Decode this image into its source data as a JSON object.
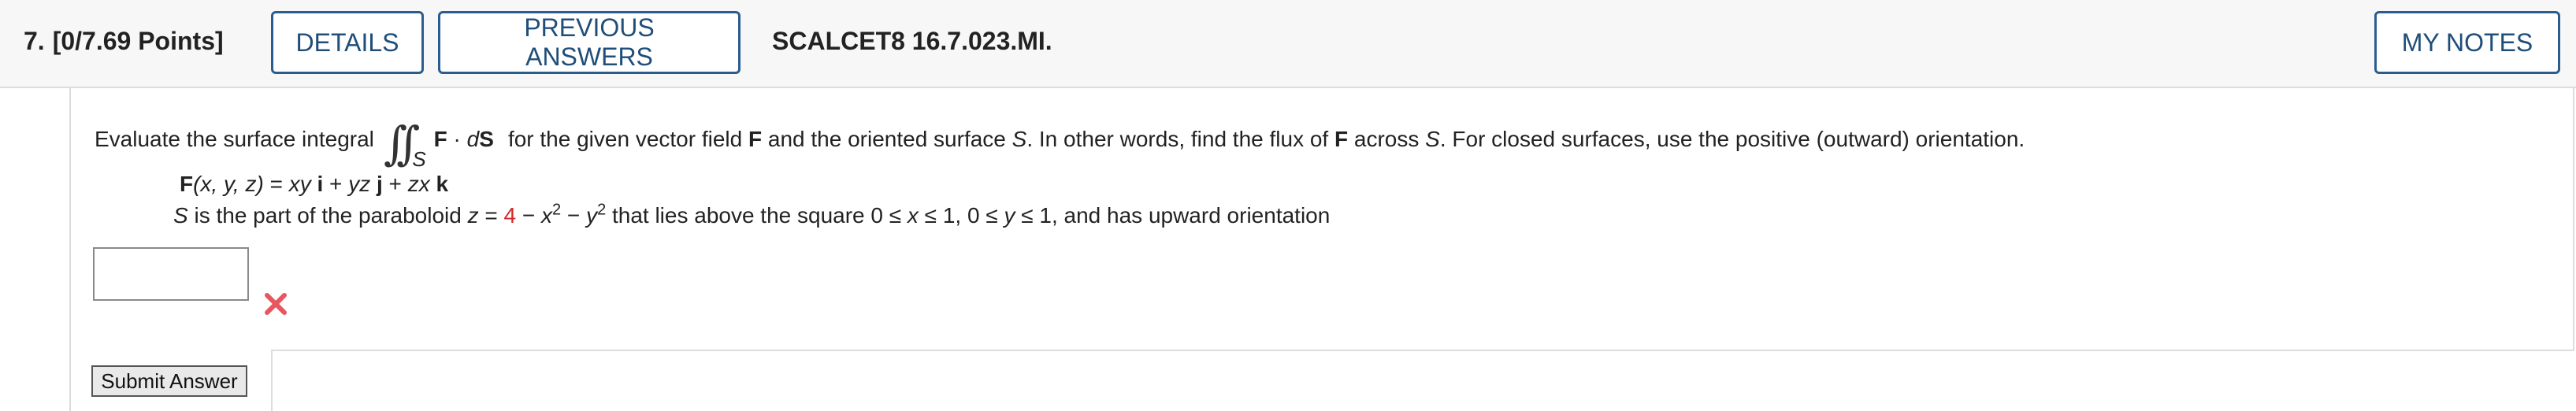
{
  "header": {
    "question_number": "7.",
    "points": "[0/7.69 Points]",
    "details_label": "DETAILS",
    "previous_answers_label": "PREVIOUS ANSWERS",
    "problem_code": "SCALCET8 16.7.023.MI.",
    "my_notes_label": "MY NOTES"
  },
  "problem": {
    "intro": "Evaluate the surface integral",
    "integral_sub": "S",
    "integrand_F": "F",
    "integrand_dot": " · ",
    "integrand_d": "d",
    "integrand_S": "S",
    "after_integral_1": "for the given vector field",
    "after_integral_F": "F",
    "after_integral_2": "and the oriented surface",
    "after_integral_S": "S",
    "after_integral_3": ". In other words, find the flux of",
    "after_integral_F2": "F",
    "after_integral_4": "across",
    "after_integral_S2": "S",
    "after_integral_5": ". For closed surfaces, use the positive (outward) orientation.",
    "field": {
      "F": "F",
      "args": "(x, y, z)",
      "eq": " = ",
      "t1": "xy",
      "i": "i",
      "plus1": " + ",
      "t2": "yz",
      "j": "j",
      "plus2": " + ",
      "t3": "zx",
      "k": "k"
    },
    "surface": {
      "S": "S",
      "text1": " is the part of the paraboloid ",
      "z": "z",
      "eq": " = ",
      "four": "4",
      "minus1": " − ",
      "x": "x",
      "exp1": "2",
      "minus2": " − ",
      "y": "y",
      "exp2": "2",
      "text2": " that lies above the square 0 ≤ ",
      "x2": "x",
      "text3": " ≤ 1, 0 ≤ ",
      "y2": "y",
      "text4": " ≤ 1,  and has upward orientation"
    }
  },
  "answer": {
    "value": "",
    "status_icon": "red-x-icon",
    "status_color": "#e8565f"
  },
  "submit_label": "Submit Answer",
  "colors": {
    "button_border": "#2a5d8f",
    "button_text": "#1f4e79",
    "highlight_number": "#d62728"
  }
}
